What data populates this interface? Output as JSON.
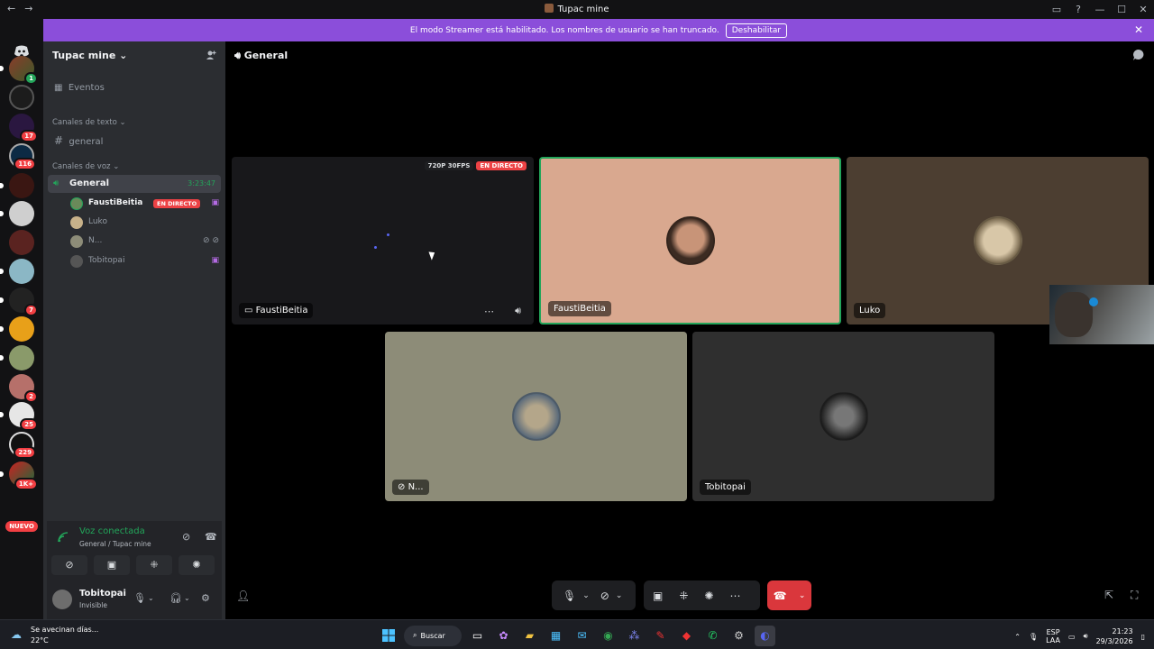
{
  "window": {
    "title": "Tupac mine",
    "back": "←",
    "forward": "→",
    "controls": [
      "▭",
      "?",
      "—",
      "☐",
      "✕"
    ]
  },
  "banner": {
    "text": "El modo Streamer está habilitado. Los nombres de usuario se han truncado.",
    "button": "Deshabilitar",
    "close": "✕"
  },
  "servers": {
    "badges": [
      "1",
      "17",
      "116",
      "7",
      "2",
      "25",
      "229",
      "1K+"
    ],
    "new_label": "NUEVO"
  },
  "sidebar": {
    "guild_name": "Tupac mine",
    "events": "Eventos",
    "text_category": "Canales de texto",
    "text_channel": "general",
    "voice_category": "Canales de voz",
    "voice_channel": {
      "name": "General",
      "time": "3:23:47"
    },
    "voice_users": [
      {
        "name": "FaustiBeitia",
        "live": "EN DIRECTO",
        "extra": "▣"
      },
      {
        "name": "Luko",
        "live": "",
        "extra": ""
      },
      {
        "name": "N...",
        "live": "",
        "extra": "⊘ ⊘"
      },
      {
        "name": "Tobitopai",
        "live": "",
        "extra": "▣"
      }
    ]
  },
  "voice_panel": {
    "status": "Voz conectada",
    "location": "General / Tupac mine"
  },
  "user": {
    "name": "Tobitopai",
    "status": "Invisible"
  },
  "main": {
    "channel_name": "General",
    "tiles": {
      "stream": {
        "name": "FaustiBeitia",
        "quality": "720P 30FPS",
        "live": "EN DIRECTO"
      },
      "fausti": {
        "name": "FaustiBeitia"
      },
      "luko": {
        "name": "Luko"
      },
      "n": {
        "name": "N..."
      },
      "tobi": {
        "name": "Tobitopai"
      }
    }
  },
  "taskbar": {
    "weather_text": "Se avecinan días...",
    "weather_temp": "22°C",
    "search": "Buscar",
    "lang_top": "ESP",
    "lang_bottom": "LAA",
    "time": "21:23",
    "date": "29/3/2026"
  }
}
